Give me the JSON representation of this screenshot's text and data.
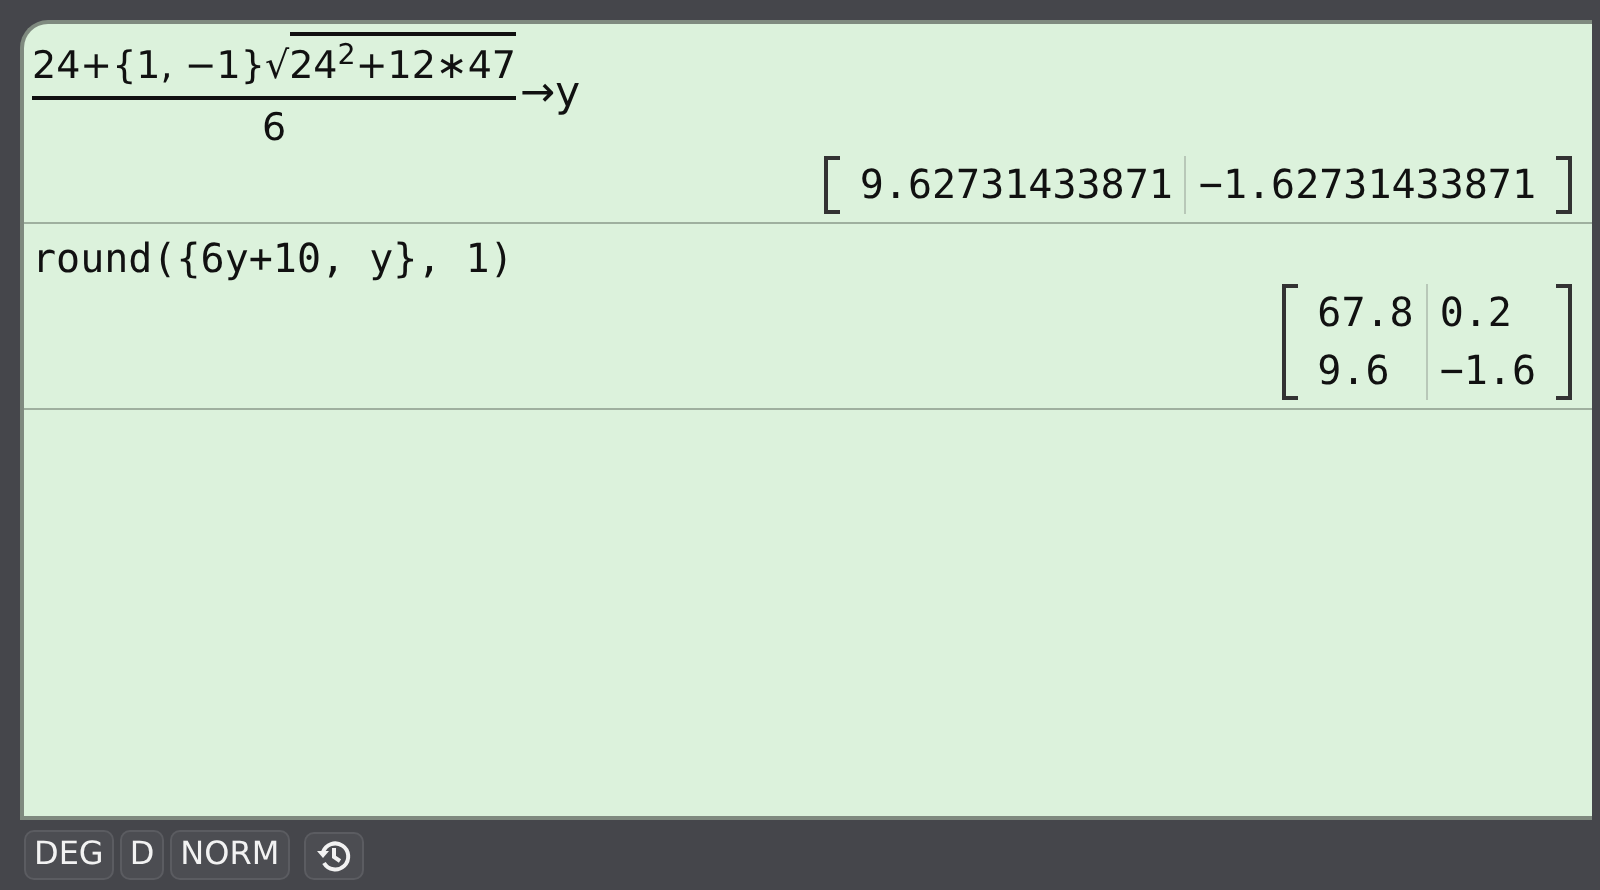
{
  "entries": [
    {
      "input": {
        "kind": "fraction",
        "numerator": "24+{1,  −1}√",
        "radicand": "24$^{2}$+12∗47",
        "denominator": "6",
        "suffix": "→y"
      },
      "result": {
        "rows": [
          [
            "9.62731433871",
            "−1.62731433871"
          ]
        ]
      }
    },
    {
      "input": {
        "kind": "text",
        "text": "round({6y+10, y}, 1)"
      },
      "result": {
        "rows": [
          [
            "67.8",
            "0.2"
          ],
          [
            "9.6",
            "−1.6"
          ]
        ]
      }
    }
  ],
  "status_bar": {
    "buttons": [
      "DEG",
      "D",
      "NORM"
    ]
  }
}
